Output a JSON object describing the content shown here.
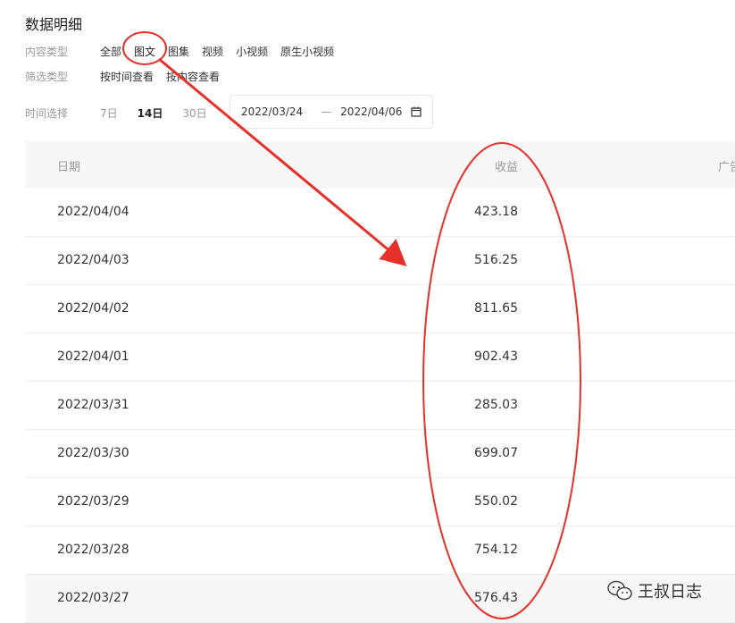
{
  "page_title": "数据明细",
  "content_type": {
    "label": "内容类型",
    "options": [
      "全部",
      "图文",
      "图集",
      "视频",
      "小视频",
      "原生小视频"
    ],
    "selected": "图文"
  },
  "filter_type": {
    "label": "筛选类型",
    "options": [
      "按时间查看",
      "按内容查看"
    ]
  },
  "time_select": {
    "label": "时间选择",
    "options": [
      "7日",
      "14日",
      "30日"
    ],
    "selected": "14日",
    "start_date": "2022/03/24",
    "separator": "—",
    "end_date": "2022/04/06"
  },
  "table": {
    "headers": {
      "date": "日期",
      "revenue": "收益",
      "ad": "广告"
    },
    "rows": [
      {
        "date": "2022/04/04",
        "revenue": "423.18"
      },
      {
        "date": "2022/04/03",
        "revenue": "516.25"
      },
      {
        "date": "2022/04/02",
        "revenue": "811.65"
      },
      {
        "date": "2022/04/01",
        "revenue": "902.43"
      },
      {
        "date": "2022/03/31",
        "revenue": "285.03"
      },
      {
        "date": "2022/03/30",
        "revenue": "699.07"
      },
      {
        "date": "2022/03/29",
        "revenue": "550.02"
      },
      {
        "date": "2022/03/28",
        "revenue": "754.12"
      },
      {
        "date": "2022/03/27",
        "revenue": "576.43"
      }
    ]
  },
  "watermark": {
    "text": "王叔日志",
    "icon": "wechat-icon"
  },
  "annotation": {
    "color": "#e8302a"
  }
}
